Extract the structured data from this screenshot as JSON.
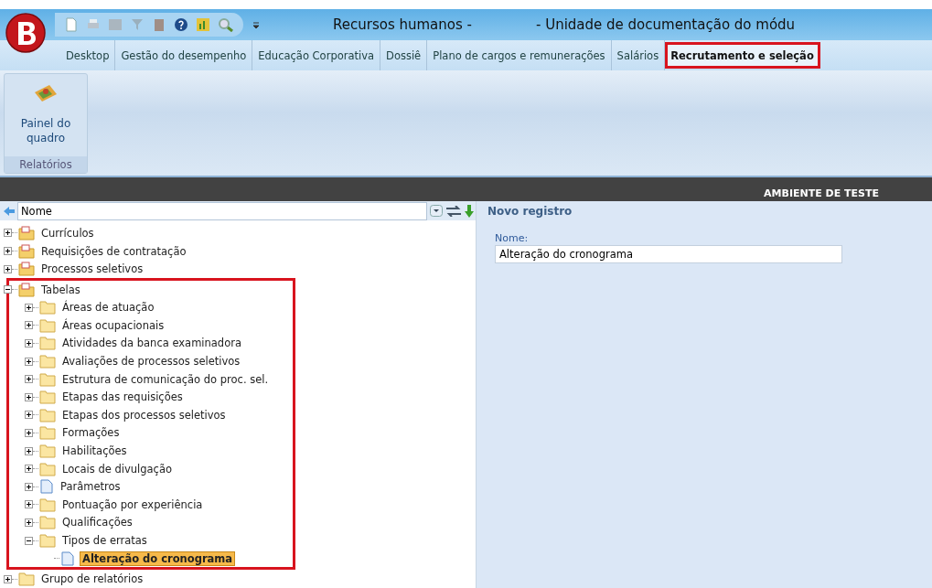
{
  "window": {
    "title_left": "Recursos humanos -",
    "title_right": "- Unidade de documentação do módu"
  },
  "tabs": [
    {
      "label": "Desktop",
      "selected": false,
      "highlighted": false
    },
    {
      "label": "Gestão do desempenho",
      "selected": false,
      "highlighted": false
    },
    {
      "label": "Educação Corporativa",
      "selected": false,
      "highlighted": false
    },
    {
      "label": "Dossiê",
      "selected": false,
      "highlighted": false
    },
    {
      "label": "Plano de cargos e remunerações",
      "selected": false,
      "highlighted": false
    },
    {
      "label": "Salários",
      "selected": false,
      "highlighted": false
    },
    {
      "label": "Recrutamento e seleção",
      "selected": true,
      "highlighted": true
    }
  ],
  "ribbon": {
    "groups": [
      {
        "buttons": [
          {
            "label": "Painel do quadro"
          }
        ],
        "label": "Relatórios"
      }
    ]
  },
  "environment_banner": "AMBIENTE DE TESTE",
  "navigator": {
    "field_value": "Nome",
    "tree": [
      {
        "label": "Currículos",
        "kind": "cabinet",
        "expanded": false,
        "highlighted": false
      },
      {
        "label": "Requisições de contratação",
        "kind": "cabinet",
        "expanded": false,
        "highlighted": false
      },
      {
        "label": "Processos seletivos",
        "kind": "cabinet",
        "expanded": false,
        "highlighted": false
      },
      {
        "label": "Tabelas",
        "kind": "cabinet",
        "expanded": true,
        "highlighted": true,
        "children": [
          {
            "label": "Áreas de atuação",
            "kind": "folder",
            "expanded": false
          },
          {
            "label": "Áreas ocupacionais",
            "kind": "folder",
            "expanded": false
          },
          {
            "label": "Atividades da banca examinadora",
            "kind": "folder",
            "expanded": false
          },
          {
            "label": "Avaliações de processos seletivos",
            "kind": "folder",
            "expanded": false
          },
          {
            "label": "Estrutura de comunicação do proc. sel.",
            "kind": "folder",
            "expanded": false
          },
          {
            "label": "Etapas das requisições",
            "kind": "folder",
            "expanded": false
          },
          {
            "label": "Etapas dos processos seletivos",
            "kind": "folder",
            "expanded": false
          },
          {
            "label": "Formações",
            "kind": "folder",
            "expanded": false
          },
          {
            "label": "Habilitações",
            "kind": "folder",
            "expanded": false
          },
          {
            "label": "Locais de divulgação",
            "kind": "folder",
            "expanded": false
          },
          {
            "label": "Parâmetros",
            "kind": "document",
            "expanded": false
          },
          {
            "label": "Pontuação por experiência",
            "kind": "folder",
            "expanded": false
          },
          {
            "label": "Qualificações",
            "kind": "folder",
            "expanded": false
          },
          {
            "label": "Tipos de erratas",
            "kind": "folder",
            "expanded": true,
            "children": [
              {
                "label": "Alteração do cronograma",
                "kind": "document",
                "selected": true
              }
            ]
          }
        ]
      },
      {
        "label": "Grupo de relatórios",
        "kind": "folder",
        "expanded": false,
        "highlighted": false
      }
    ]
  },
  "form": {
    "heading": "Novo registro",
    "field_label": "Nome:",
    "field_value": "Alteração do cronograma"
  }
}
